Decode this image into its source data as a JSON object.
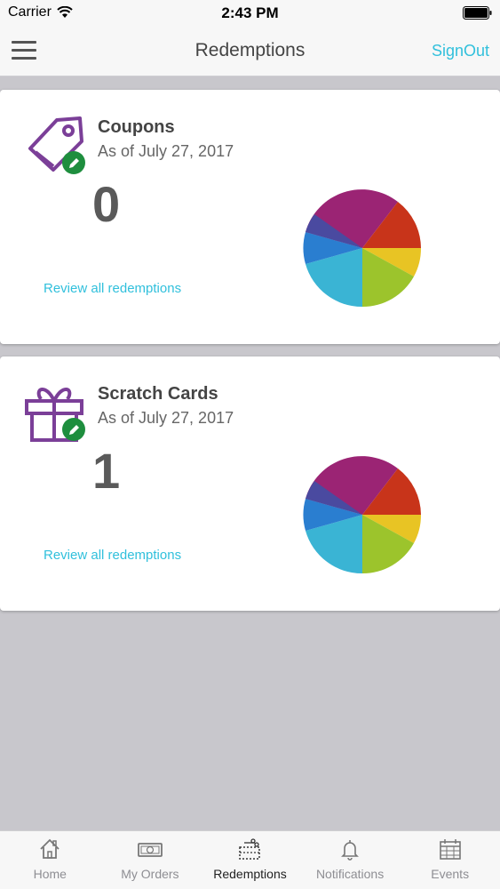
{
  "status_bar": {
    "carrier": "Carrier",
    "time": "2:43 PM"
  },
  "nav": {
    "title": "Redemptions",
    "signout_label": "SignOut"
  },
  "cards": [
    {
      "title": "Coupons",
      "date": "As of July 27, 2017",
      "count": "0",
      "link": "Review all redemptions",
      "icon": "tag-icon"
    },
    {
      "title": "Scratch Cards",
      "date": "As of July 27, 2017",
      "count": "1",
      "link": "Review all redemptions",
      "icon": "gift-icon"
    }
  ],
  "tabs": [
    {
      "label": "Home",
      "icon": "home-icon",
      "active": false
    },
    {
      "label": "My Orders",
      "icon": "money-icon",
      "active": false
    },
    {
      "label": "Redemptions",
      "icon": "coupon-cut-icon",
      "active": true
    },
    {
      "label": "Notifications",
      "icon": "bell-icon",
      "active": false
    },
    {
      "label": "Events",
      "icon": "calendar-icon",
      "active": false
    }
  ],
  "colors": {
    "accent": "#31c0dc",
    "icon_purple": "#7b3f98",
    "badge_green": "#1e8e3e",
    "background": "#c8c7cc",
    "card": "#ffffff"
  }
}
